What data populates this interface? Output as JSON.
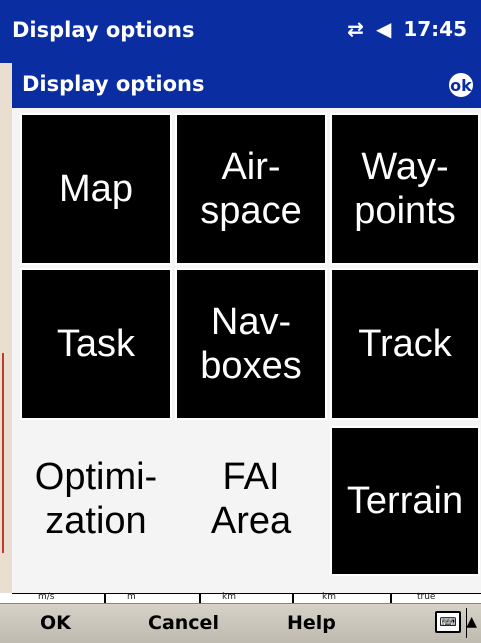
{
  "titlebar": {
    "title": "Display options",
    "time": "17:45",
    "icons": [
      "connectivity-icon",
      "speaker-icon"
    ]
  },
  "dialog": {
    "title": "Display options",
    "ok_label": "ok",
    "tiles": [
      {
        "label": "Map",
        "style": "dark"
      },
      {
        "label": "Air-\nspace",
        "style": "dark"
      },
      {
        "label": "Way-\npoints",
        "style": "dark"
      },
      {
        "label": "Task",
        "style": "dark"
      },
      {
        "label": "Nav-\nboxes",
        "style": "dark"
      },
      {
        "label": "Track",
        "style": "dark"
      },
      {
        "label": "Optimi-\nzation",
        "style": "light"
      },
      {
        "label": "FAI\nArea",
        "style": "light"
      },
      {
        "label": "Terrain",
        "style": "dark"
      }
    ]
  },
  "datarow": {
    "units": [
      "m/s",
      "m",
      "km",
      "km",
      "true"
    ]
  },
  "menubar": {
    "ok": "OK",
    "cancel": "Cancel",
    "help": "Help"
  },
  "colors": {
    "titlebar": "#0a2ea1",
    "tile_dark": "#000000",
    "tile_light": "#f4f4f4"
  }
}
